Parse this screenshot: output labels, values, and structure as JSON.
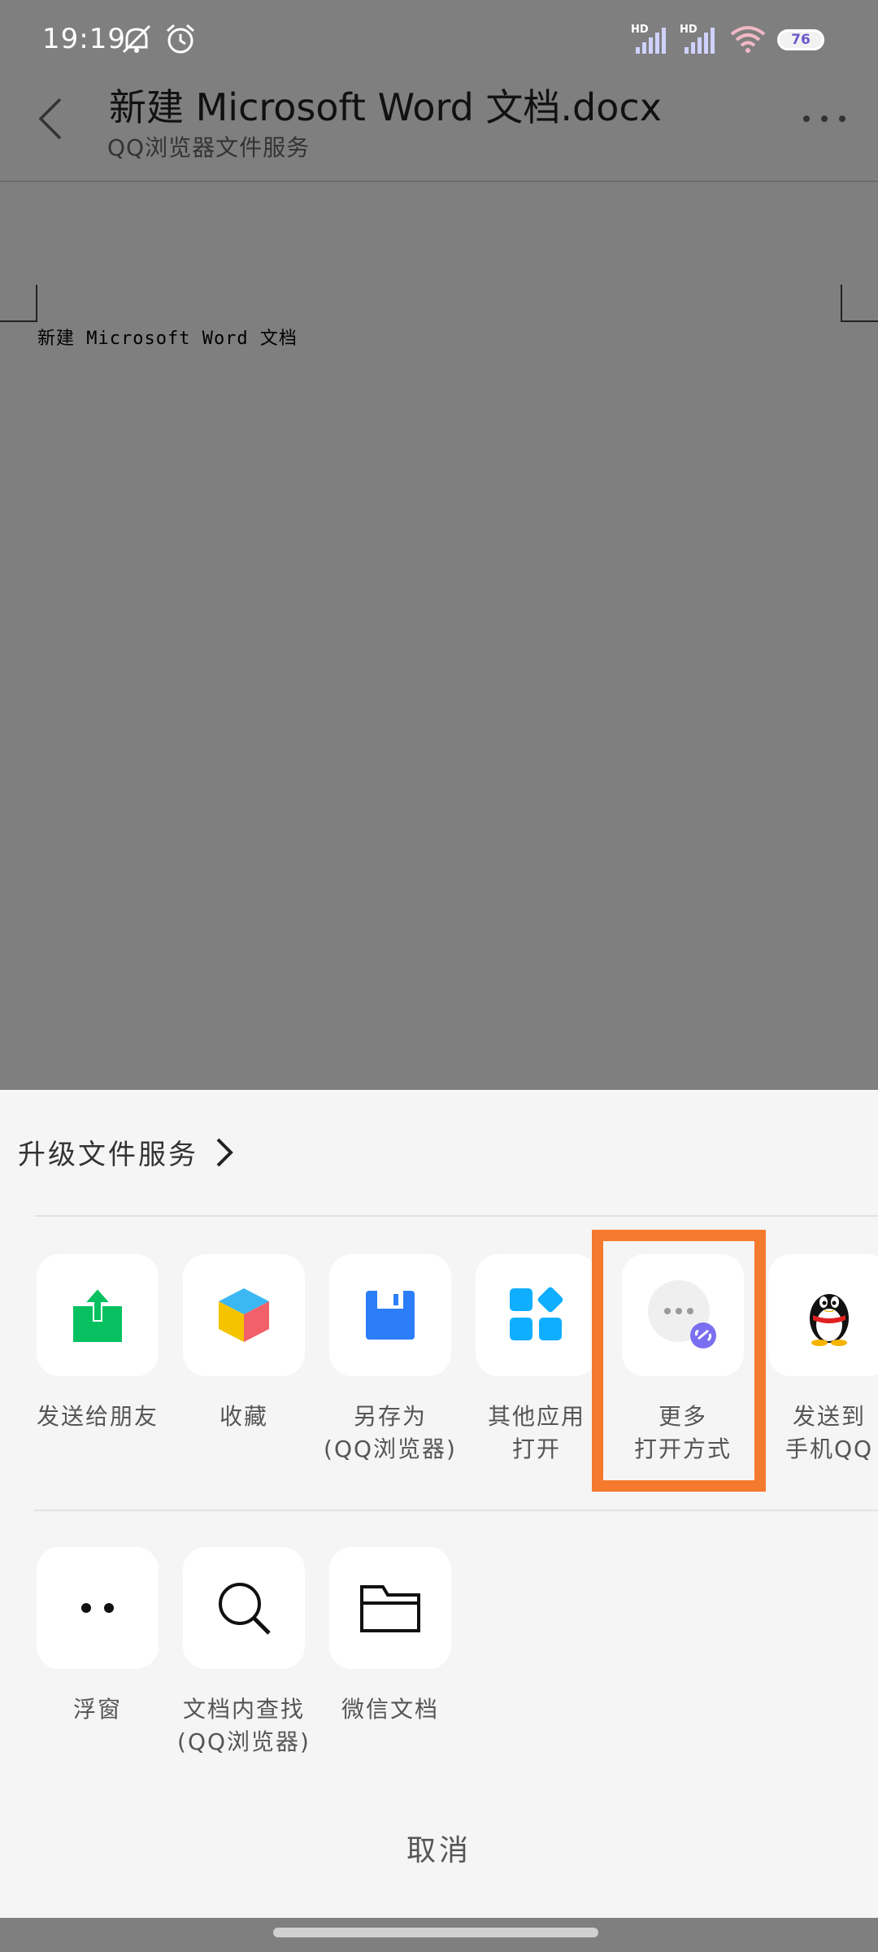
{
  "status_bar": {
    "time": "19:19",
    "icons": [
      "mute-notification-icon",
      "alarm-icon",
      "signal-hd-icon",
      "signal-hd-icon",
      "wifi-icon"
    ],
    "signal_label_1": "HD",
    "signal_label_2": "HD",
    "battery": "76"
  },
  "app_bar": {
    "title": "新建 Microsoft Word 文档.docx",
    "subtitle": "QQ浏览器文件服务",
    "back_icon": "chevron-left-icon",
    "more_icon": "more-horizontal-icon"
  },
  "document": {
    "body_text": "新建 Microsoft Word 文档"
  },
  "sheet": {
    "upgrade_label": "升级文件服务",
    "row1": [
      {
        "label": "发送给朋友",
        "icon": "share-upload-icon",
        "color": "#07c160"
      },
      {
        "label": "收藏",
        "icon": "cube-favorite-icon",
        "color": "#f5c300"
      },
      {
        "label": "另存为\n(QQ浏览器)",
        "icon": "save-floppy-icon",
        "color": "#2c7ef8"
      },
      {
        "label": "其他应用\n打开",
        "icon": "apps-grid-icon",
        "color": "#10aeff"
      },
      {
        "label": "更多\n打开方式",
        "icon": "more-open-icon",
        "color": "#bdbdbd"
      },
      {
        "label": "发送到\n手机QQ",
        "icon": "qq-penguin-icon",
        "color": "#000000"
      }
    ],
    "row2": [
      {
        "label": "浮窗",
        "icon": "floating-window-icon"
      },
      {
        "label": "文档内查找\n(QQ浏览器)",
        "icon": "search-icon"
      },
      {
        "label": "微信文档",
        "icon": "folder-icon"
      }
    ],
    "cancel_label": "取消",
    "highlight_color": "#f57a2e"
  }
}
